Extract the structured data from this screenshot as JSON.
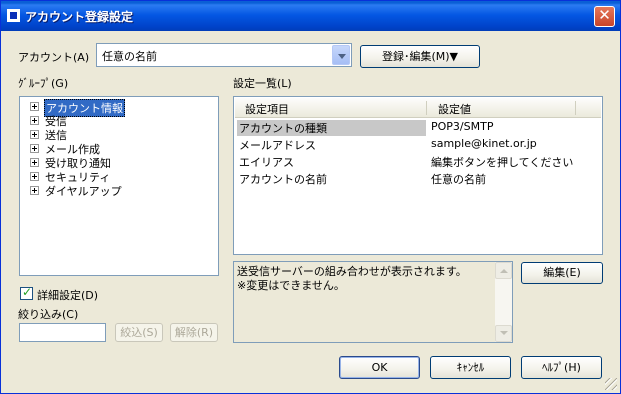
{
  "window": {
    "title": "アカウント登録設定",
    "close_glyph": "✕"
  },
  "account": {
    "label": "アカウント(A)",
    "selected": "任意の名前",
    "register_edit_button": "登録･編集(M)▼"
  },
  "group": {
    "label": "ｸﾞﾙｰﾌﾟ(G)",
    "items": [
      {
        "label": "アカウント情報",
        "selected": true
      },
      {
        "label": "受信",
        "selected": false
      },
      {
        "label": "送信",
        "selected": false
      },
      {
        "label": "メール作成",
        "selected": false
      },
      {
        "label": "受け取り通知",
        "selected": false
      },
      {
        "label": "セキュリティ",
        "selected": false
      },
      {
        "label": "ダイヤルアップ",
        "selected": false
      }
    ]
  },
  "settings": {
    "label": "設定一覧(L)",
    "columns": [
      "設定項目",
      "設定値"
    ],
    "rows": [
      {
        "item": "アカウントの種類",
        "value": "POP3/SMTP",
        "selected": true
      },
      {
        "item": "メールアドレス",
        "value": "sample@kinet.or.jp",
        "selected": false
      },
      {
        "item": "エイリアス",
        "value": "編集ボタンを押してください",
        "selected": false
      },
      {
        "item": "アカウントの名前",
        "value": "任意の名前",
        "selected": false
      }
    ]
  },
  "description": {
    "text": "送受信サーバーの組み合わせが表示されます。\n※変更はできません。"
  },
  "edit_button": "編集(E)",
  "detail_checkbox": {
    "label": "詳細設定(D)",
    "checked": true
  },
  "filter": {
    "label": "絞り込み(C)",
    "value": "",
    "apply_button": "絞込(S)",
    "clear_button": "解除(R)"
  },
  "footer": {
    "ok": "OK",
    "cancel": "ｷｬﾝｾﾙ",
    "help": "ﾍﾙﾌﾟ(H)"
  },
  "colors": {
    "titlebar": "#0457e3",
    "selection": "#316ac5",
    "dialog_bg": "#ece9d8"
  }
}
